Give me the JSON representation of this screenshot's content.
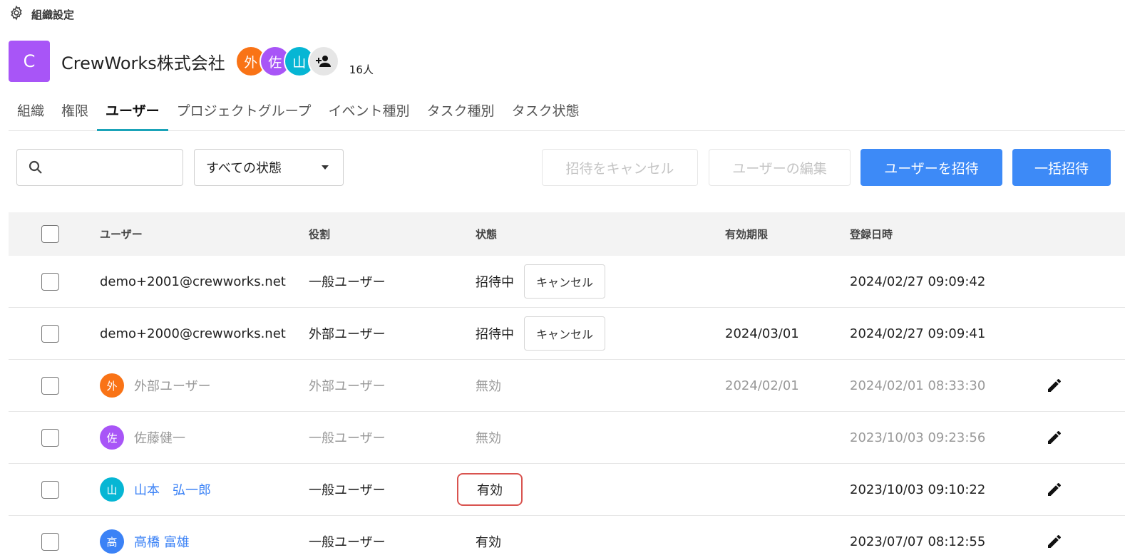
{
  "header": {
    "title": "組織設定",
    "icon": "gear-icon"
  },
  "org": {
    "logo_letter": "C",
    "logo_color": "#a855f7",
    "name": "CrewWorks株式会社",
    "avatars": [
      {
        "label": "外",
        "color": "#f97316"
      },
      {
        "label": "佐",
        "color": "#a855f7"
      },
      {
        "label": "山",
        "color": "#06b6d4"
      }
    ],
    "add_member_icon": "person-add-icon",
    "member_count": "16人"
  },
  "tabs": [
    {
      "label": "組織",
      "active": false
    },
    {
      "label": "権限",
      "active": false
    },
    {
      "label": "ユーザー",
      "active": true
    },
    {
      "label": "プロジェクトグループ",
      "active": false
    },
    {
      "label": "イベント種別",
      "active": false
    },
    {
      "label": "タスク種別",
      "active": false
    },
    {
      "label": "タスク状態",
      "active": false
    }
  ],
  "toolbar": {
    "search_placeholder": "",
    "status_filter": "すべての状態",
    "cancel_invite": "招待をキャンセル",
    "edit_user": "ユーザーの編集",
    "invite_user": "ユーザーを招待",
    "bulk_invite": "一括招待"
  },
  "table": {
    "columns": {
      "user": "ユーザー",
      "role": "役割",
      "status": "状態",
      "expire": "有効期限",
      "registered": "登録日時"
    },
    "rows": [
      {
        "user": "demo+2001@crewworks.net",
        "avatar": "",
        "avatar_color": "",
        "role": "一般ユーザー",
        "status": "招待中",
        "action": "キャンセル",
        "expire": "",
        "registered": "2024/02/27 09:09:42",
        "editable": false,
        "disabled": false,
        "highlight": false
      },
      {
        "user": "demo+2000@crewworks.net",
        "avatar": "",
        "avatar_color": "",
        "role": "外部ユーザー",
        "status": "招待中",
        "action": "キャンセル",
        "expire": "2024/03/01",
        "registered": "2024/02/27 09:09:41",
        "editable": false,
        "disabled": false,
        "highlight": false
      },
      {
        "user": "外部ユーザー",
        "avatar": "外",
        "avatar_color": "#f97316",
        "role": "外部ユーザー",
        "status": "無効",
        "action": "",
        "expire": "2024/02/01",
        "registered": "2024/02/01 08:33:30",
        "editable": true,
        "disabled": true,
        "highlight": false
      },
      {
        "user": "佐藤健一",
        "avatar": "佐",
        "avatar_color": "#a855f7",
        "role": "一般ユーザー",
        "status": "無効",
        "action": "",
        "expire": "",
        "registered": "2023/10/03 09:23:56",
        "editable": true,
        "disabled": true,
        "highlight": false
      },
      {
        "user": "山本　弘一郎",
        "avatar": "山",
        "avatar_color": "#06b6d4",
        "role": "一般ユーザー",
        "status": "有効",
        "action": "",
        "expire": "",
        "registered": "2023/10/03 09:10:22",
        "editable": true,
        "disabled": false,
        "highlight": true
      },
      {
        "user": "高橋 富雄",
        "avatar": "高",
        "avatar_color": "#3b82f6",
        "role": "一般ユーザー",
        "status": "有効",
        "action": "",
        "expire": "",
        "registered": "2023/07/07 08:12:55",
        "editable": true,
        "disabled": false,
        "highlight": false
      }
    ]
  }
}
